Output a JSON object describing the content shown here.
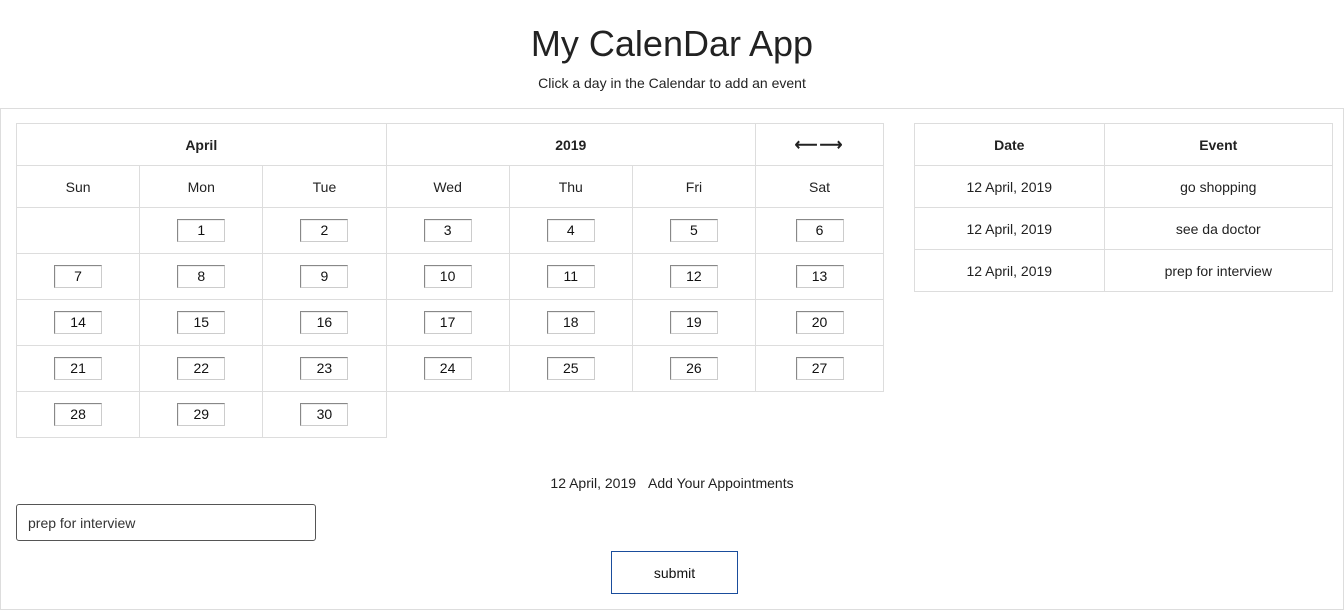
{
  "header": {
    "title": "My CalenDar App",
    "subtitle": "Click a day in the Calendar to add an event"
  },
  "calendar": {
    "month": "April",
    "year": "2019",
    "nav_icons": [
      "arrow-left-icon",
      "arrow-right-icon"
    ],
    "weekdays": [
      "Sun",
      "Mon",
      "Tue",
      "Wed",
      "Thu",
      "Fri",
      "Sat"
    ],
    "weeks": [
      [
        "",
        "1",
        "2",
        "3",
        "4",
        "5",
        "6"
      ],
      [
        "7",
        "8",
        "9",
        "10",
        "11",
        "12",
        "13"
      ],
      [
        "14",
        "15",
        "16",
        "17",
        "18",
        "19",
        "20"
      ],
      [
        "21",
        "22",
        "23",
        "24",
        "25",
        "26",
        "27"
      ],
      [
        "28",
        "29",
        "30",
        "",
        "",
        "",
        ""
      ]
    ]
  },
  "events": {
    "headers": [
      "Date",
      "Event"
    ],
    "rows": [
      [
        "12 April, 2019",
        "go shopping"
      ],
      [
        "12 April, 2019",
        "see da doctor"
      ],
      [
        "12 April, 2019",
        "prep for interview"
      ]
    ]
  },
  "form": {
    "selected_date": "12 April, 2019",
    "prompt": "Add Your Appointments",
    "input_value": "prep for interview",
    "submit_label": "submit"
  }
}
